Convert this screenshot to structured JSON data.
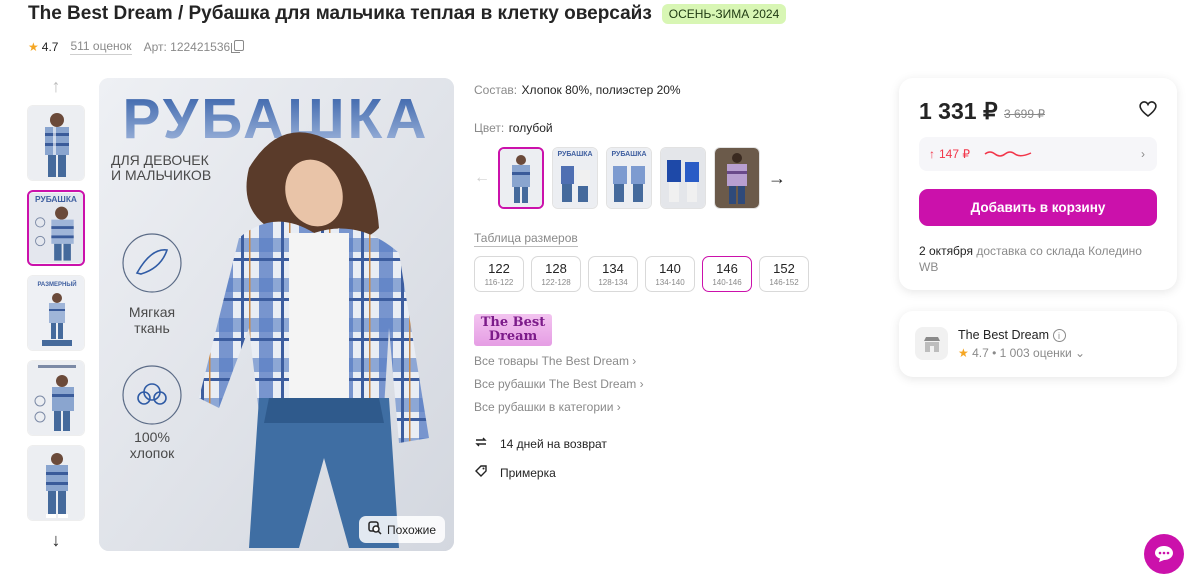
{
  "product": {
    "title": "The Best Dream / Рубашка для мальчика теплая в клетку оверсайз",
    "season_badge": "ОСЕНЬ-ЗИМА 2024",
    "rating": "4.7",
    "reviews": "511 оценок",
    "article": "Арт: 122421536"
  },
  "photo": {
    "headline": "РУБАШКА",
    "subline1": "ДЛЯ ДЕВОЧЕК",
    "subline2": "И МАЛЬЧИКОВ",
    "feature1a": "Мягкая",
    "feature1b": "ткань",
    "feature2a": "100%",
    "feature2b": "хлопок",
    "similar": "Похожие"
  },
  "thumbs": {
    "thumb2_label": "РУБАШКА",
    "thumb3_label": "РАЗМЕРНЫЙ"
  },
  "details": {
    "composition_label": "Состав:",
    "composition_value": "Хлопок 80%, полиэстер 20%",
    "color_label": "Цвет:",
    "color_value": "голубой",
    "swatch2_label": "РУБАШКА",
    "swatch3_label": "РУБАШКА",
    "size_table": "Таблица размеров",
    "sizes": [
      {
        "n": "122",
        "r": "116-122"
      },
      {
        "n": "128",
        "r": "122-128"
      },
      {
        "n": "134",
        "r": "128-134"
      },
      {
        "n": "140",
        "r": "134-140"
      },
      {
        "n": "146",
        "r": "140-146"
      },
      {
        "n": "152",
        "r": "146-152"
      }
    ],
    "brand_logo1": "The Best",
    "brand_logo2": "Dream",
    "links": [
      "Все товары The Best Dream",
      "Все рубашки The Best Dream",
      "Все рубашки в категории"
    ],
    "return_policy": "14 дней на возврат",
    "fitting": "Примерка"
  },
  "price_card": {
    "price": "1 331 ₽",
    "old_price": "3 699 ₽",
    "wallet_discount": "147 ₽",
    "add_to_cart": "Добавить в корзину",
    "delivery_date": "2 октября",
    "delivery_text": "доставка со склада Коледино WB"
  },
  "seller": {
    "name": "The Best Dream",
    "rating": "4.7",
    "reviews": "1 003 оценки"
  },
  "colors": {
    "accent": "#cb11ab",
    "badge_bg": "#d8f6b4",
    "discount": "#f2364a",
    "star": "#f5a623"
  }
}
